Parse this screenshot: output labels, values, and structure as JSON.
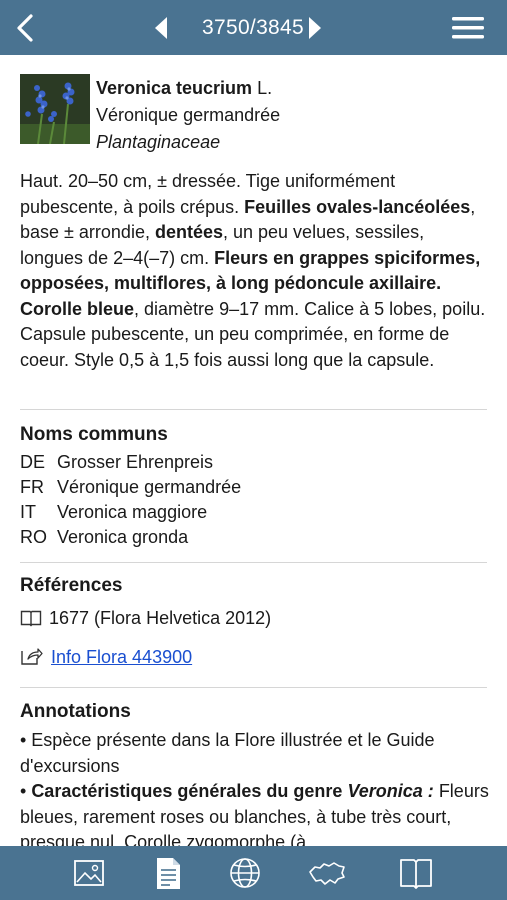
{
  "header": {
    "counter": "3750/3845"
  },
  "species": {
    "scientific_name": "Veronica teucrium",
    "author": "L.",
    "common_name": "Véronique germandrée",
    "family": "Plantaginaceae"
  },
  "description": {
    "p1": "Haut. 20–50 cm, ± dressée. Tige uniformément pubescente, à poils crépus. ",
    "b1": "Feuilles ovales-lancéolées",
    "p2": ", base ± arrondie, ",
    "b2": "dentées",
    "p3": ", un peu velues, sessiles, longues de 2–4(–7) cm. ",
    "b3": "Fleurs en grappes spiciformes, opposées, multiflores, à long pédoncule axillaire. Corolle bleue",
    "p4": ", diamètre 9–17 mm. Calice à 5 lobes, poilu. Capsule pubescente, un peu comprimée, en forme de coeur. Style 0,5 à 1,5 fois aussi long que la capsule."
  },
  "common_names": {
    "title": "Noms communs",
    "rows": [
      {
        "lang": "DE",
        "name": "Grosser Ehrenpreis"
      },
      {
        "lang": "FR",
        "name": "Véronique germandrée"
      },
      {
        "lang": "IT",
        "name": "Veronica maggiore"
      },
      {
        "lang": "RO",
        "name": "Veronica gronda"
      }
    ]
  },
  "references": {
    "title": "Références",
    "book_ref": "1677 (Flora Helvetica 2012)",
    "link_label": "Info Flora 443900"
  },
  "annotations": {
    "title": "Annotations",
    "item1": "• Espèce présente dans la Flore illustrée et le Guide d'excursions",
    "item2_bullet": "• ",
    "item2_bold": "Caractéristiques générales du genre ",
    "item2_bold_italic": "Veronica :",
    "item2_text": " Fleurs bleues, rarement roses ou blanches, à tube très court, presque nul. Corolle zygomorphe (à"
  },
  "toolbar": {
    "icons": [
      "image-icon",
      "document-icon",
      "globe-icon",
      "switzerland-map-icon",
      "book-icon"
    ]
  },
  "colors": {
    "bar": "#4a7391",
    "link": "#1a4fd0",
    "divider": "#d6d6d6"
  }
}
